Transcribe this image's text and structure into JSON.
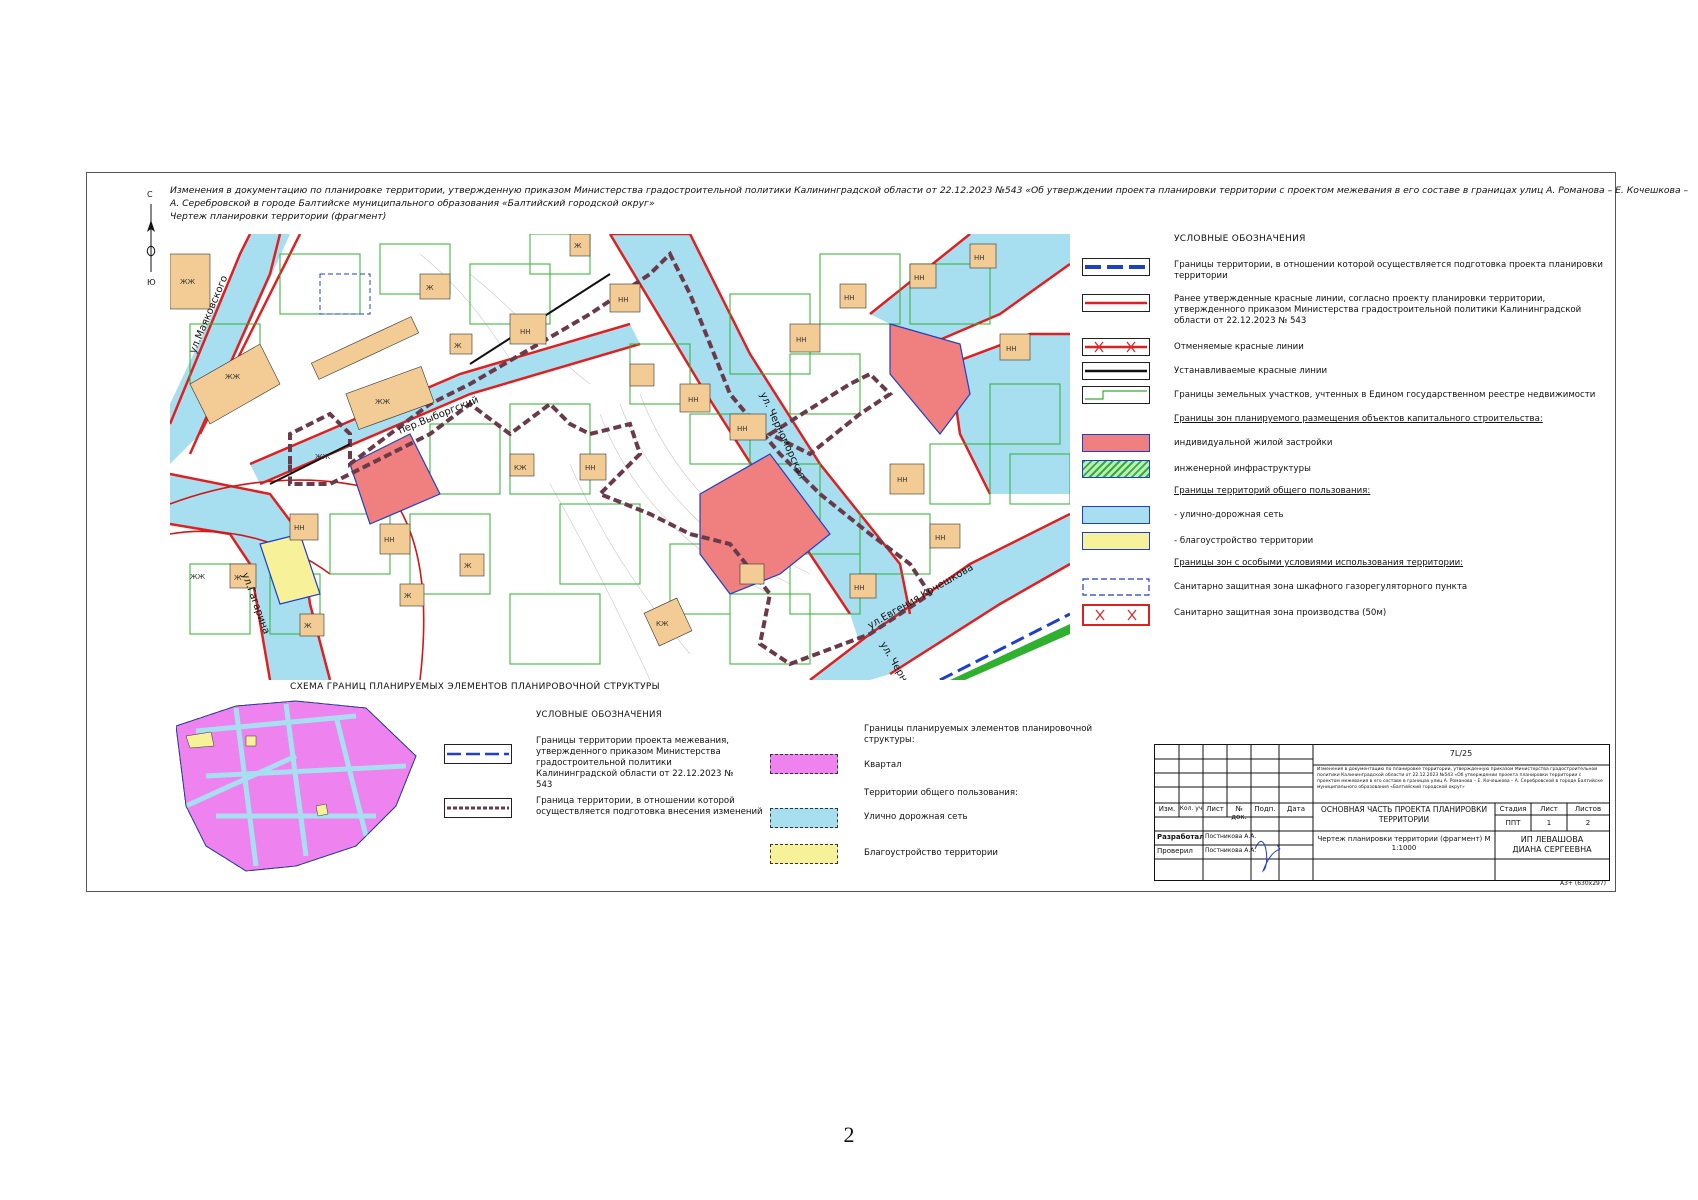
{
  "header": {
    "line1": "Изменения в документацию по планировке территории, утвержденную приказом Министерства градостроительной политики Калининградской области от 22.12.2023 №543 «Об утверждении проекта планировки территории с проектом межевания в его составе в границах улиц А. Романова – Е. Кочешкова –",
    "line2": "А. Серебровской в городе Балтийске муниципального образования «Балтийский городской округ»",
    "line3": "Чертеж планировки территории (фрагмент)"
  },
  "compass": {
    "north": "С",
    "south": "Ю"
  },
  "streets": {
    "mayakovskogo": "ул.Маяковского",
    "vyborgsky": "пер.Выборгский",
    "chernomorskaya": "ул. Черноморская",
    "gagarina": "ул.Гагарина",
    "kocheshkova": "ул.Евгения Кочешкова",
    "chernomor2": "ул. Черномо"
  },
  "map_labels": [
    "ЖЖ",
    "ЖЖ",
    "ЖЖ",
    "ЖЖ",
    "ЖЖ",
    "НН",
    "НН",
    "НН",
    "НН",
    "НН",
    "НН",
    "НН",
    "НН",
    "НН",
    "НН",
    "НН",
    "НН",
    "НН",
    "НН",
    "НН",
    "КЖ",
    "КЖ",
    "Ж",
    "Ж",
    "Ж",
    "Ж",
    "Ж",
    "Ж",
    "Ж"
  ],
  "legend": {
    "title": "УСЛОВНЫЕ ОБОЗНАЧЕНИЯ",
    "items": [
      {
        "text": "Границы территории, в отношении которой осуществляется подготовка проекта планировки территории"
      },
      {
        "text": "Ранее утвержденные красные линии, согласно проекту планировки территории, утвержденного приказом Министерства градостроительной политики Калининградской области от 22.12.2023 № 543"
      },
      {
        "text": "Отменяемые красные линии"
      },
      {
        "text": "Устанавливаемые красные линии"
      },
      {
        "text": "Границы земельных участков, учтенных в Едином государственном реестре недвижимости"
      },
      {
        "text": "Границы зон планируемого размещения объектов капитального строительства:"
      },
      {
        "text": "индивидуальной жилой застройки"
      },
      {
        "text": "инженерной инфраструктуры"
      },
      {
        "text": "Границы территорий общего пользования:"
      },
      {
        "text": "- улично-дорожная сеть"
      },
      {
        "text": "- благоустройство территории"
      },
      {
        "text": "Границы зон с особыми условиями использования территории:"
      },
      {
        "text": "Санитарно защитная зона шкафного газорегуляторного пункта"
      },
      {
        "text": "Санитарно защитная зона производства (50м)"
      }
    ]
  },
  "scheme": {
    "title": "СХЕМА ГРАНИЦ ПЛАНИРУЕМЫХ ЭЛЕМЕНТОВ ПЛАНИРОВОЧНОЙ СТРУКТУРЫ",
    "legend_title": "УСЛОВНЫЕ ОБОЗНАЧЕНИЯ",
    "item1": "Границы территории проекта межевания, утвержденного приказом Министерства градостроительной политики Калининградской области от 22.12.2023 № 543",
    "item2": "Граница территории, в отношении которой осуществляется подготовка внесения изменений",
    "elements_title": "Границы планируемых элементов планировочной структуры:",
    "kvartal": "Квартал",
    "public_title": "Территории общего пользования:",
    "road": "Улично дорожная сеть",
    "improvement": "Благоустройство территории"
  },
  "stamp": {
    "code": "7L/25",
    "desc": "Изменения в документацию по планировке территории, утвержденную приказом Министерства градостроительной политики Калининградской области от 22.12.2023 №543 «Об утверждении проекта планировки территории с проектом межевания в его составе в границах улиц А. Романова – Е. Кочешкова – А. Серебровской в городе Балтийске муниципального образования «Балтийский городской округ»",
    "cols": [
      "Изм.",
      "Кол. уч",
      "Лист",
      "№ док.",
      "Подп.",
      "Дата"
    ],
    "section": "ОСНОВНАЯ ЧАСТЬ ПРОЕКТА ПЛАНИРОВКИ ТЕРРИТОРИИ",
    "stage_h": "Стадия",
    "sheet_h": "Лист",
    "sheets_h": "Листов",
    "stage": "ППТ",
    "sheet": "1",
    "sheets": "2",
    "developed_label": "Разработал",
    "developed_name": "Постникова А.А.",
    "checked_label": "Проверил",
    "checked_name": "Постникова А.А.",
    "drawing": "Чертеж планировки территории (фрагмент) М 1:1000",
    "org": "ИП ЛЕВАШОВА ДИАНА СЕРГЕЕВНА"
  },
  "format": "А3+ (630х297)",
  "page_number": "2",
  "colors": {
    "road": "#a7dff0",
    "red": "#e02020",
    "pink": "#f08080",
    "green": "#2fb02f",
    "dashed_purple": "#6b3a4a",
    "blue": "#1e3fc8",
    "building": "#f2cc94",
    "magenta": "#ee82ee",
    "yellow": "#f7f29a"
  }
}
